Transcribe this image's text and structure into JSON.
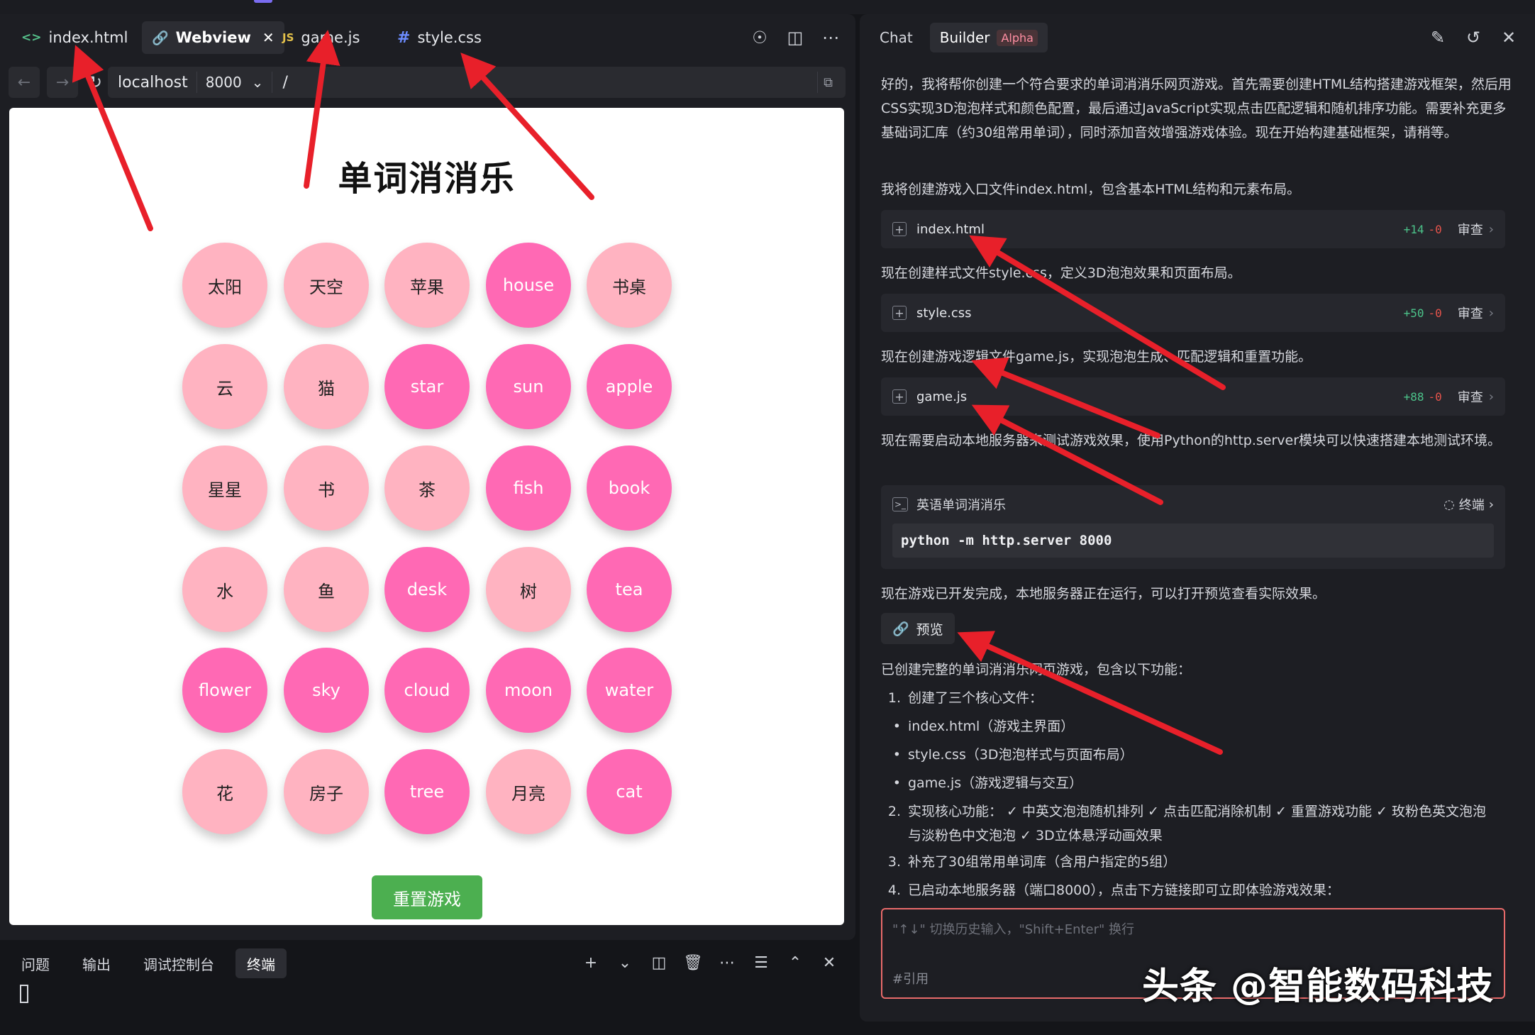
{
  "editor": {
    "tabs": [
      {
        "label": "index.html",
        "icon": "code-icon"
      },
      {
        "label": "Webview",
        "icon": "webview-icon",
        "active": true
      },
      {
        "label": "game.js",
        "icon": "js-icon"
      },
      {
        "label": "style.css",
        "icon": "css-hash-icon"
      }
    ],
    "tab_icons": {
      "code": "<>",
      "js": "JS",
      "css": "#"
    },
    "address": {
      "host": "localhost",
      "port": "8000",
      "path": "/"
    }
  },
  "game": {
    "title": "单词消消乐",
    "colors": {
      "chinese": "#ffb3c1",
      "english": "#ff69b4",
      "reset": "#4caf50"
    },
    "rows": [
      [
        {
          "t": "太阳",
          "k": "cn"
        },
        {
          "t": "天空",
          "k": "cn"
        },
        {
          "t": "苹果",
          "k": "cn"
        },
        {
          "t": "house",
          "k": "en"
        },
        {
          "t": "书桌",
          "k": "cn"
        }
      ],
      [
        {
          "t": "云",
          "k": "cn"
        },
        {
          "t": "猫",
          "k": "cn"
        },
        {
          "t": "star",
          "k": "en"
        },
        {
          "t": "sun",
          "k": "en"
        },
        {
          "t": "apple",
          "k": "en"
        }
      ],
      [
        {
          "t": "星星",
          "k": "cn"
        },
        {
          "t": "书",
          "k": "cn"
        },
        {
          "t": "茶",
          "k": "cn"
        },
        {
          "t": "fish",
          "k": "en"
        },
        {
          "t": "book",
          "k": "en"
        }
      ],
      [
        {
          "t": "水",
          "k": "cn"
        },
        {
          "t": "鱼",
          "k": "cn"
        },
        {
          "t": "desk",
          "k": "en"
        },
        {
          "t": "树",
          "k": "cn"
        },
        {
          "t": "tea",
          "k": "en"
        }
      ],
      [
        {
          "t": "flower",
          "k": "en"
        },
        {
          "t": "sky",
          "k": "en"
        },
        {
          "t": "cloud",
          "k": "en"
        },
        {
          "t": "moon",
          "k": "en"
        },
        {
          "t": "water",
          "k": "en"
        }
      ],
      [
        {
          "t": "花",
          "k": "cn"
        },
        {
          "t": "房子",
          "k": "cn"
        },
        {
          "t": "tree",
          "k": "en"
        },
        {
          "t": "月亮",
          "k": "cn"
        },
        {
          "t": "cat",
          "k": "en"
        }
      ]
    ],
    "reset_label": "重置游戏"
  },
  "bottom": {
    "tabs": [
      "问题",
      "输出",
      "调试控制台",
      "终端"
    ]
  },
  "chat": {
    "tabs": {
      "chat": "Chat",
      "builder": "Builder",
      "alpha": "Alpha"
    },
    "intro": "好的，我将帮你创建一个符合要求的单词消消乐网页游戏。首先需要创建HTML结构搭建游戏框架，然后用CSS实现3D泡泡样式和颜色配置，最后通过JavaScript实现点击匹配逻辑和随机排序功能。需要补充更多基础词汇库（约30组常用单词），同时添加音效增强游戏体验。现在开始构建基础框架，请稍等。",
    "step1": "我将创建游戏入口文件index.html，包含基本HTML结构和元素布局。",
    "step2": "现在创建样式文件style.css，定义3D泡泡效果和页面布局。",
    "step3": "现在创建游戏逻辑文件game.js，实现泡泡生成、匹配逻辑和重置功能。",
    "step4": "现在需要启动本地服务器来测试游戏效果，使用Python的http.server模块可以快速搭建本地测试环境。",
    "files": [
      {
        "name": "index.html",
        "add": "+14",
        "del": "-0",
        "action": "审查"
      },
      {
        "name": "style.css",
        "add": "+50",
        "del": "-0",
        "action": "审查"
      },
      {
        "name": "game.js",
        "add": "+88",
        "del": "-0",
        "action": "审查"
      }
    ],
    "terminal": {
      "title": "英语单词消消乐",
      "label": "终端",
      "command": "python -m http.server 8000"
    },
    "done": "现在游戏已开发完成，本地服务器正在运行，可以打开预览查看实际效果。",
    "preview_label": "预览",
    "summary_head": "已创建完整的单词消消乐网页游戏，包含以下功能：",
    "list": {
      "n1": "1.",
      "i1": "创建了三个核心文件：",
      "b1": "index.html（游戏主界面）",
      "b2": "style.css（3D泡泡样式与页面布局）",
      "b3": "game.js（游戏逻辑与交互）",
      "n2": "2.",
      "i2": "实现核心功能： ✓ 中英文泡泡随机排列 ✓ 点击匹配消除机制 ✓ 重置游戏功能 ✓ 玫粉色英文泡泡与淡粉色中文泡泡 ✓ 3D立体悬浮动画效果",
      "n3": "3.",
      "i3": "补充了30组常用单词库（含用户指定的5组）",
      "n4": "4.",
      "i4": "已启动本地服务器（端口8000），点击下方链接即可立即体验游戏效果："
    },
    "input": {
      "placeholder": "\"↑↓\" 切换历史输入，\"Shift+Enter\" 换行",
      "quote": "#引用"
    }
  },
  "watermark": "头条 @智能数码科技",
  "annotation_color": "#e8202a"
}
